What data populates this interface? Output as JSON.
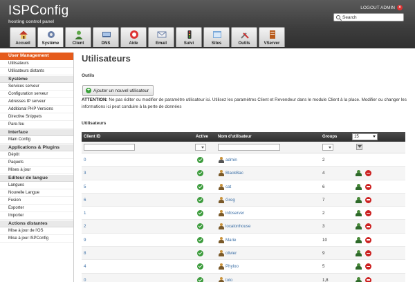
{
  "app": {
    "logo": "ISPConfig",
    "subtitle": "hosting control panel",
    "logout": "LOGOUT ADMIN",
    "search_placeholder": "Search"
  },
  "tabs": [
    {
      "label": "Accueil",
      "icon": "home-icon"
    },
    {
      "label": "Système",
      "icon": "system-icon",
      "active": true
    },
    {
      "label": "Client",
      "icon": "client-icon"
    },
    {
      "label": "DNS",
      "icon": "dns-icon"
    },
    {
      "label": "Aide",
      "icon": "help-icon"
    },
    {
      "label": "Email",
      "icon": "email-icon"
    },
    {
      "label": "Suivi",
      "icon": "monitor-icon"
    },
    {
      "label": "Sites",
      "icon": "sites-icon"
    },
    {
      "label": "Outils",
      "icon": "tools-icon"
    },
    {
      "label": "VServer",
      "icon": "vserver-icon"
    }
  ],
  "sidebar": [
    {
      "title": "User Management",
      "active": true,
      "items": [
        "Utilisateurs",
        "Utilisateurs distants"
      ]
    },
    {
      "title": "Système",
      "items": [
        "Services serveur",
        "Configuration serveur",
        "Adresses IP serveur",
        "Additional PHP Versions",
        "Directive Snippets",
        "Pare-feu"
      ]
    },
    {
      "title": "Interface",
      "items": [
        "Main Config"
      ]
    },
    {
      "title": "Applications & Plugins",
      "items": [
        "Dépôt",
        "Paquets",
        "Mises à jour"
      ]
    },
    {
      "title": "Editeur de langue",
      "items": [
        "Langues",
        "Nouvelle Langue",
        "Fusion",
        "Exporter",
        "Importer"
      ]
    },
    {
      "title": "Actions distantes",
      "items": [
        "Mise à jour de l'OS",
        "Mise à jour ISPConfig"
      ]
    }
  ],
  "main": {
    "title": "Utilisateurs",
    "tools_label": "Outils",
    "add_button": "Ajouter un nouvel utilisateur",
    "attention_prefix": "ATTENTION:",
    "attention_text": " Ne pas éditer ou modifier de paramètre utilisateur ici. Utilisez les paramètres Client et Revendeur dans le module Client à la place. Modifier ou changer les informations ici peut conduire à la perte de données",
    "users_label": "Utilisateurs",
    "columns": {
      "client_id": "Client ID",
      "active": "Active",
      "username": "Nom d'utilisateur",
      "groups": "Groups"
    },
    "per_page": "15",
    "rows": [
      {
        "client_id": "0",
        "username": "admin",
        "groups": "2",
        "admin": true,
        "actions": false
      },
      {
        "client_id": "3",
        "username": "BlackBac",
        "groups": "4",
        "actions": true
      },
      {
        "client_id": "5",
        "username": "cat",
        "groups": "6",
        "actions": true
      },
      {
        "client_id": "6",
        "username": "Greg",
        "groups": "7",
        "actions": true
      },
      {
        "client_id": "1",
        "username": "infoserver",
        "groups": "2",
        "actions": true
      },
      {
        "client_id": "2",
        "username": "localonhouse",
        "groups": "3",
        "actions": true
      },
      {
        "client_id": "9",
        "username": "Marie",
        "groups": "10",
        "actions": true
      },
      {
        "client_id": "8",
        "username": "olivier",
        "groups": "9",
        "actions": true
      },
      {
        "client_id": "4",
        "username": "Phyloo",
        "groups": "5",
        "actions": true
      },
      {
        "client_id": "0",
        "username": "toto",
        "groups": "1,8",
        "actions": true
      }
    ]
  }
}
